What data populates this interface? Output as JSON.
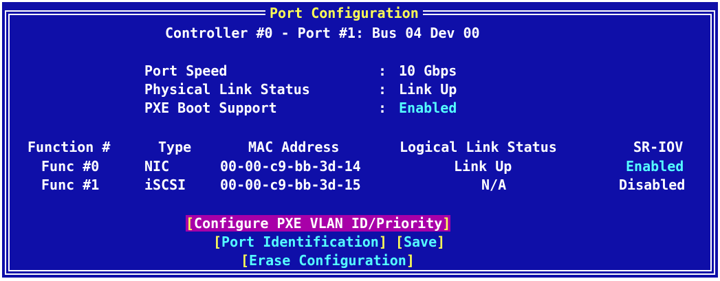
{
  "title": "Port Configuration",
  "subtitle": "Controller #0 - Port #1: Bus 04 Dev 00",
  "info": [
    {
      "label": "Port Speed",
      "value": "10 Gbps"
    },
    {
      "label": "Physical Link Status",
      "value": "Link Up"
    },
    {
      "label": "PXE Boot Support",
      "value": "Enabled"
    }
  ],
  "colon": ":",
  "table": {
    "headers": [
      "Function #",
      "Type",
      "MAC Address",
      "Logical Link Status",
      "SR-IOV"
    ],
    "rows": [
      {
        "func": "Func #0",
        "type": "NIC",
        "mac": "00-00-c9-bb-3d-14",
        "link": "Link Up",
        "sriov": "Enabled"
      },
      {
        "func": "Func #1",
        "type": "iSCSI",
        "mac": "00-00-c9-bb-3d-15",
        "link": "N/A",
        "sriov": "Disabled"
      }
    ]
  },
  "buttons": {
    "configure_pxe": "Configure PXE VLAN ID/Priority",
    "port_identification": "Port Identification",
    "save": "Save",
    "erase": "Erase Configuration",
    "open_bracket": "[",
    "close_bracket": "]"
  },
  "colors": {
    "background": "#0f0fa8",
    "title": "#ffff55",
    "highlight_value": "#55ffff",
    "selection": "#a800a8"
  }
}
